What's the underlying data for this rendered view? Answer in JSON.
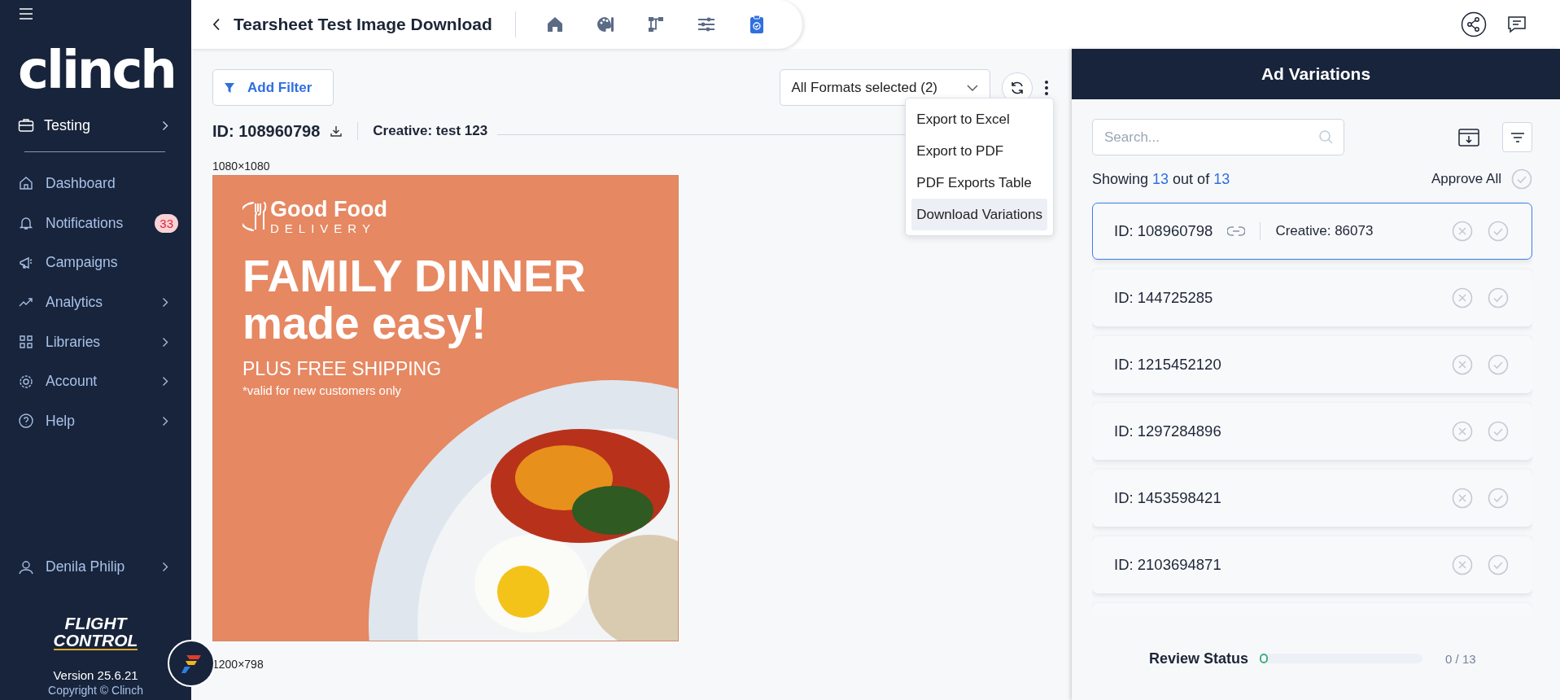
{
  "sidebar": {
    "logo": "clinch",
    "workspace": "Testing",
    "items": [
      {
        "kind": "dashboard",
        "label": "Dashboard",
        "expandable": false
      },
      {
        "kind": "notifications",
        "label": "Notifications",
        "expandable": false,
        "badge": "33"
      },
      {
        "kind": "campaigns",
        "label": "Campaigns",
        "expandable": false
      },
      {
        "kind": "analytics",
        "label": "Analytics",
        "expandable": true
      },
      {
        "kind": "libraries",
        "label": "Libraries",
        "expandable": true
      },
      {
        "kind": "account",
        "label": "Account",
        "expandable": true
      },
      {
        "kind": "help",
        "label": "Help",
        "expandable": true
      }
    ],
    "user": "Denila Philip",
    "brand_lines": [
      "FLIGHT",
      "CONTROL"
    ],
    "version": "Version 25.6.21",
    "copyright": "Copyright © Clinch"
  },
  "topbar": {
    "title": "Tearsheet Test Image Download",
    "tools": [
      {
        "kind": "home",
        "selected": false
      },
      {
        "kind": "palette",
        "selected": false
      },
      {
        "kind": "flow",
        "selected": false
      },
      {
        "kind": "sliders",
        "selected": false
      },
      {
        "kind": "clipboard",
        "selected": true
      }
    ]
  },
  "toolbar": {
    "add_filter": "Add Filter",
    "formats": "All Formats selected (2)",
    "menu": [
      {
        "label": "Export to Excel",
        "highlighted": false
      },
      {
        "label": "Export to PDF",
        "highlighted": false
      },
      {
        "label": "PDF Exports Table",
        "highlighted": false
      },
      {
        "label": "Download Variations",
        "highlighted": true
      }
    ]
  },
  "preview": {
    "id": "ID: 108960798",
    "creative": "Creative: test 123",
    "formats": [
      {
        "size": "1080×1080",
        "ad": {
          "brand": "Good Food",
          "brand_sub": "DELIVERY",
          "headline": "FAMILY DINNER",
          "subhead": "made easy!",
          "offer": "PLUS FREE SHIPPING",
          "note": "*valid for new customers only"
        }
      },
      {
        "size": "1200×798"
      }
    ]
  },
  "panel": {
    "title": "Ad Variations",
    "search": {
      "placeholder": "Search..."
    },
    "showing": {
      "prefix": "Showing",
      "shown": "13",
      "middle": "out of",
      "total": "13"
    },
    "approve_all": "Approve All",
    "variations": [
      {
        "id": "ID: 108960798",
        "creative": "Creative: 86073",
        "selected": true
      },
      {
        "id": "ID: 144725285",
        "selected": false
      },
      {
        "id": "ID: 1215452120",
        "selected": false
      },
      {
        "id": "ID: 1297284896",
        "selected": false
      },
      {
        "id": "ID: 1453598421",
        "selected": false
      },
      {
        "id": "ID: 2103694871",
        "selected": false
      }
    ],
    "review": {
      "label": "Review Status",
      "level": 0,
      "count": "0 / 13"
    }
  }
}
